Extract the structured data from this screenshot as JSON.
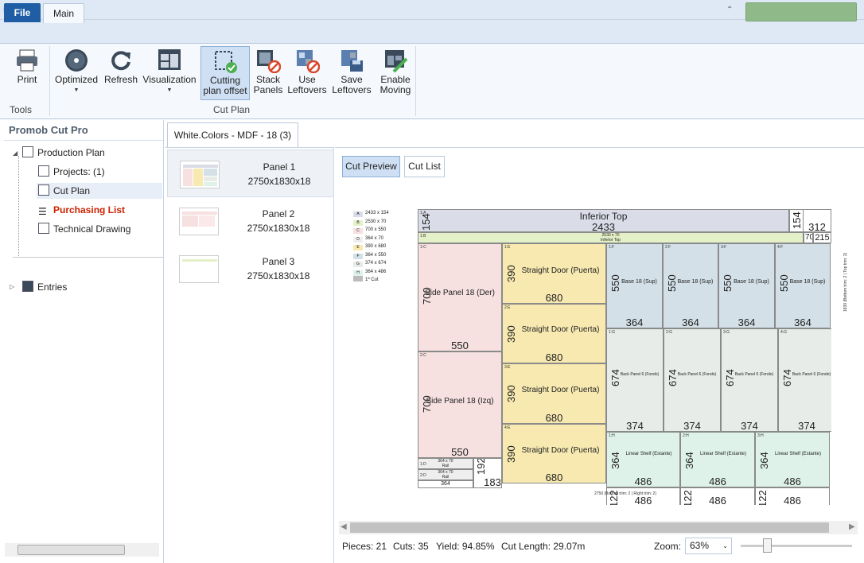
{
  "ribbon": {
    "file_tab": "File",
    "main_tab": "Main",
    "buttons": {
      "print": "Print",
      "optimized": "Optimized",
      "refresh": "Refresh",
      "visualization": "Visualization",
      "cutting_plan_offset_1": "Cutting",
      "cutting_plan_offset_2": "plan offset",
      "stack_panels_1": "Stack",
      "stack_panels_2": "Panels",
      "use_leftovers_1": "Use",
      "use_leftovers_2": "Leftovers",
      "save_leftovers_1": "Save",
      "save_leftovers_2": "Leftovers",
      "enable_moving_1": "Enable",
      "enable_moving_2": "Moving"
    },
    "groups": {
      "tools": "Tools",
      "cut_plan": "Cut Plan"
    }
  },
  "sidebar": {
    "brand": "Promob Cut Pro",
    "tree": {
      "production_plan": "Production Plan",
      "projects": "Projects: (1)",
      "cut_plan": "Cut Plan",
      "purchasing_list": "Purchasing List",
      "technical_drawing": "Technical Drawing",
      "entries": "Entries"
    }
  },
  "doc_tab": "White.Colors - MDF - 18 (3)",
  "panels": [
    {
      "name": "Panel 1",
      "size": "2750x1830x18"
    },
    {
      "name": "Panel 2",
      "size": "2750x1830x18"
    },
    {
      "name": "Panel 3",
      "size": "2750x1830x18"
    }
  ],
  "views": {
    "cut_preview": "Cut Preview",
    "cut_list": "Cut List"
  },
  "legend": [
    {
      "key": "A",
      "text": "2433 x 154",
      "color": "#dadce8"
    },
    {
      "key": "B",
      "text": "2530 x 70",
      "color": "#e4f0c8"
    },
    {
      "key": "C",
      "text": "700 x 550",
      "color": "#f6e0e0"
    },
    {
      "key": "D",
      "text": "364 x 70",
      "color": "#eeeeee"
    },
    {
      "key": "E",
      "text": "390 x 680",
      "color": "#f7e9b0"
    },
    {
      "key": "F",
      "text": "364 x 550",
      "color": "#d3e0e8"
    },
    {
      "key": "G",
      "text": "374 x 674",
      "color": "#e8ece8"
    },
    {
      "key": "H",
      "text": "364 x 486",
      "color": "#def2ea"
    },
    {
      "key": "",
      "text": "1ª Cut",
      "color": "#bbbbbb"
    }
  ],
  "sheet": {
    "inferior_top": "Inferior Top",
    "inferior_top_w": "2433",
    "inferior_top_h": "154",
    "strip_154": "154",
    "leftover_312": "312",
    "rail_label": "2530 x 70",
    "rail_sub": "Inferior Top",
    "strip_70": "70",
    "leftover_215": "215",
    "side_der": "Side Panel 18 (Der)",
    "side_izq": "Side Panel 18 (Izq)",
    "side_w": "550",
    "side_h": "700",
    "door": "Straight Door (Puerta)",
    "door_w": "680",
    "door_h": "390",
    "base": "Base 18 (Sup)",
    "base_w": "364",
    "base_h": "550",
    "back": "Back Panel 6 (Fondo)",
    "back_w": "374",
    "back_h": "674",
    "shelf": "Linear Shelf (Estante)",
    "shelf_w": "486",
    "shelf_h": "364",
    "rail_small": "364 x 70",
    "rail_small_sub": "Rail",
    "small_364": "364",
    "leftover_192": "192",
    "leftover_183": "183",
    "bottom_122": "122",
    "bottom_note": "2750 (Bottom trim: 2 | Right trim: 2)",
    "right_note": "1830 (Bottom trim: 2 | Top trim: 2)",
    "tags": {
      "a1": "1:A",
      "b1": "1:B",
      "c1": "1:C",
      "c2": "2:C",
      "e1": "1:E",
      "e2": "2:E",
      "e3": "3:E",
      "e4": "4:E",
      "f1": "1:F",
      "f2": "2:F",
      "f3": "3:F",
      "f4": "4:F",
      "g1": "1:G",
      "g2": "2:G",
      "g3": "3:G",
      "g4": "4:G",
      "h1": "1:H",
      "h2": "2:H",
      "h3": "3:H",
      "d1": "1:D",
      "d2": "2:D"
    }
  },
  "status": {
    "pieces": "Pieces: 21",
    "cuts": "Cuts: 35",
    "yield": "Yield: 94.85%",
    "cut_length": "Cut Length: 29.07m",
    "zoom_label": "Zoom:",
    "zoom_value": "63%"
  }
}
